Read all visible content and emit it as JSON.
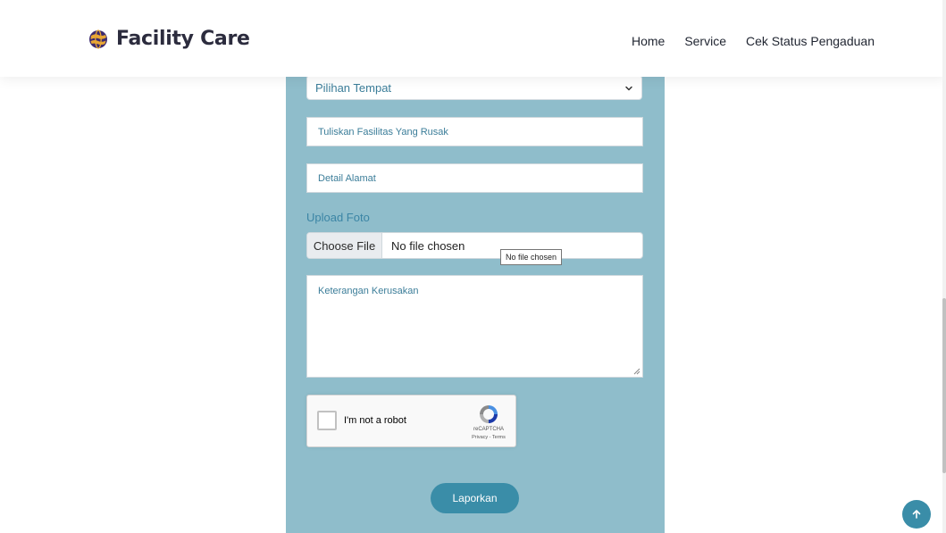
{
  "navbar": {
    "brand": "Facility Care",
    "links": [
      "Home",
      "Service",
      "Cek Status Pengaduan"
    ]
  },
  "form": {
    "location_select": "Pilihan Tempat",
    "facility_placeholder": "Tuliskan Fasilitas Yang Rusak",
    "address_placeholder": "Detail Alamat",
    "upload_label": "Upload Foto",
    "file_button": "Choose File",
    "file_status": "No file chosen",
    "file_tooltip": "No file chosen",
    "description_placeholder": "Keterangan Kerusakan",
    "submit_label": "Laporkan"
  },
  "captcha": {
    "label": "I'm not a robot",
    "brand": "reCAPTCHA",
    "links": "Privacy - Terms"
  },
  "icons": {
    "brand_logo": "globe-icon",
    "select_chevron": "chevron-down-icon",
    "back_to_top": "arrow-up-icon",
    "captcha_logo": "recaptcha-icon"
  },
  "colors": {
    "panel": "#8fbdcb",
    "accent": "#3a8da8",
    "placeholder": "#3b7d99"
  }
}
